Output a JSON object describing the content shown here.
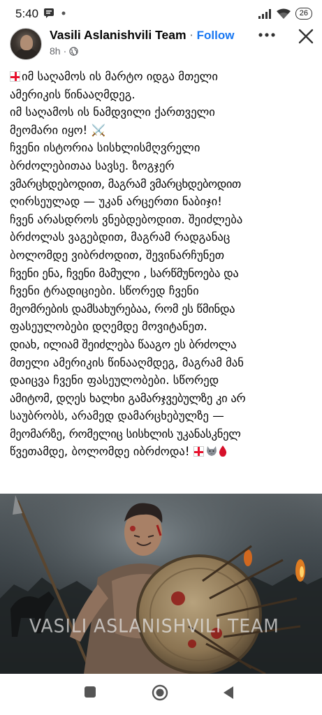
{
  "status_bar": {
    "time": "5:40",
    "battery": "26",
    "icons": [
      "message-icon",
      "notification-dot-icon",
      "signal-icon",
      "wifi-icon",
      "battery-icon"
    ]
  },
  "post": {
    "author": "Vasili Aslanishvili Team",
    "separator": "·",
    "follow_label": "Follow",
    "time_ago": "8h",
    "meta_separator": "·",
    "privacy_icon": "globe-icon",
    "more_icon": "more-options-icon",
    "close_icon": "close-icon",
    "text_lines": [
      "იმ საღამოს ის მარტო იდგა მთელი",
      "ამერიკის წინააღმდეგ.",
      "იმ საღამოს ის ნამდვილი ქართველი",
      "მეომარი იყო! ⚔️",
      "  ჩვენი ისტორია სისხლისმღვრელი",
      "ბრძოლებითაა სავსე. ზოგჯერ",
      "ვმარცხდებოდით, მაგრამ ვმარცხდებოდით",
      "ღირსეულად — უკან არცერთი ნაბიჯი!",
      "  ჩვენ არასდროს ვნებდებოდით. შეიძლება",
      "ბრძოლას ვაგებდით, მაგრამ რადგანაც",
      "ბოლომდე ვიბრძოდით, შევინარჩუნეთ",
      "ჩვენი ენა, ჩვენი მამული , სარწმუნოება და",
      "ჩვენი ტრადიციები. სწორედ ჩვენი",
      "მეომრების დამსახურებაა, რომ ეს წმინდა",
      "ფასეულობები დღემდე მოვიტანეთ.",
      "დიახ, ილიამ შეიძლება წააგო ეს ბრძოლა",
      "მთელი ამერიკის წინააღმდეგ, მაგრამ მან",
      "დაიცვა ჩვენი ფასეულობები. სწორედ",
      "ამიტომ, დღეს ხალხი გამარჯვებულზე კი არ",
      "საუბრობს, არამედ დამარცხებულზე —",
      "მეომარზე, რომელიც სისხლის უკანასკნელ",
      "წვეთამდე, ბოლომდე იბრძოდა! "
    ],
    "leading_emoji": "georgian-flag-icon",
    "trailing_emojis": [
      "georgian-flag-icon",
      "wolf-icon",
      "blood-drop-icon"
    ],
    "image": {
      "description_icon": "warrior-with-shield-image",
      "watermark": "VASILI ASLANISHVILI TEAM"
    }
  },
  "nav": {
    "recents_icon": "square-recents-icon",
    "home_icon": "circle-home-icon",
    "back_icon": "triangle-back-icon"
  },
  "colors": {
    "link": "#1877f2",
    "text": "#050505",
    "meta": "#65676b",
    "flag_red": "#e8112d"
  }
}
